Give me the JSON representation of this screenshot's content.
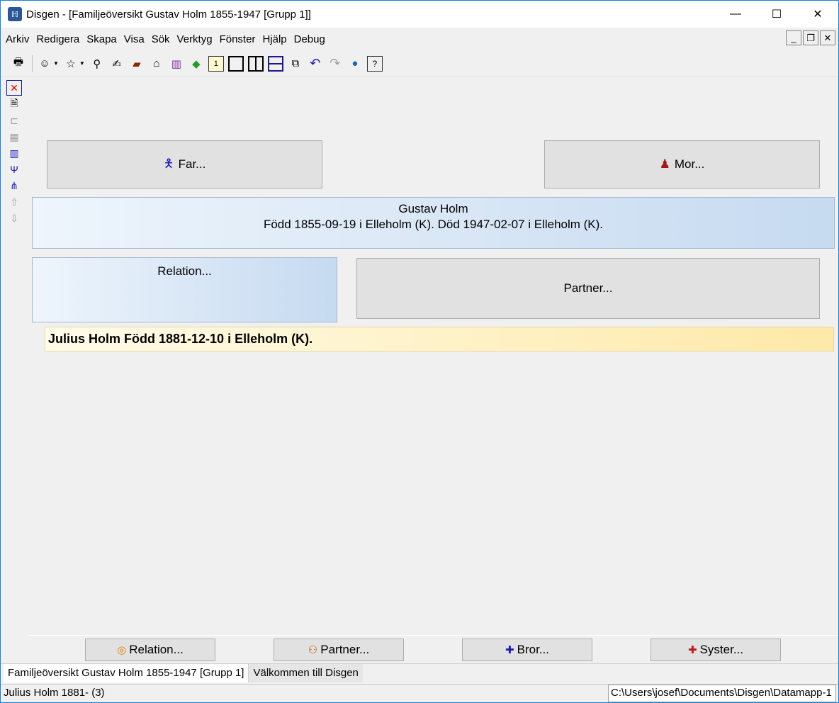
{
  "window": {
    "app_name": "Disgen",
    "title": "Disgen  - [Familjeöversikt Gustav Holm 1855-1947 [Grupp 1]]",
    "minimize": "—",
    "maximize": "☐",
    "close": "✕"
  },
  "menu": [
    "Arkiv",
    "Redigera",
    "Skapa",
    "Visa",
    "Sök",
    "Verktyg",
    "Fönster",
    "Hjälp",
    "Debug"
  ],
  "mdi": {
    "minimize": "_",
    "restore": "❐",
    "close": "✕"
  },
  "toolbar_icons": [
    "print-icon",
    "person-icon",
    "search-person-icon",
    "binoculars-icon",
    "hand-icon",
    "book-icon",
    "home-icon",
    "books-icon",
    "map-icon",
    "calendar-icon",
    "window-single-icon",
    "window-split-vertical-icon",
    "window-split-horizontal-icon",
    "window-cascade-icon",
    "undo-icon",
    "redo-icon",
    "globe-icon",
    "help-icon"
  ],
  "sidebar_icons": [
    "delete-icon",
    "document-icon",
    "tree-icon",
    "tree-grid-icon",
    "columns-icon",
    "ancestors-icon",
    "descendants-icon",
    "move-up-icon",
    "move-down-icon"
  ],
  "family": {
    "father_button": "Far...",
    "mother_button": "Mor...",
    "main_name": "Gustav Holm",
    "main_details": "Född 1855-09-19 i Elleholm (K). Död 1947-02-07 i Elleholm (K).",
    "relation_label": "Relation...",
    "partner_button": "Partner...",
    "child": "Julius Holm Född 1881-12-10 i Elleholm (K)."
  },
  "bottom_buttons": {
    "relation": "Relation...",
    "partner": "Partner...",
    "brother": "Bror...",
    "sister": "Syster..."
  },
  "tabs": {
    "active": "Familjeöversikt Gustav Holm 1855-1947 [Grupp 1]",
    "inactive": "Välkommen till Disgen"
  },
  "status": {
    "left": "Julius Holm 1881- (3)",
    "right": "C:\\Users\\josef\\Documents\\Disgen\\Datamapp-1"
  },
  "colors": {
    "window_border": "#1883d7",
    "main_gradient_start": "#eef5fc",
    "main_gradient_end": "#c6daf0",
    "child_gradient_start": "#fffbe9",
    "child_gradient_end": "#fde9a8",
    "male_icon": "#1a1ab0",
    "female_icon": "#a01818"
  }
}
